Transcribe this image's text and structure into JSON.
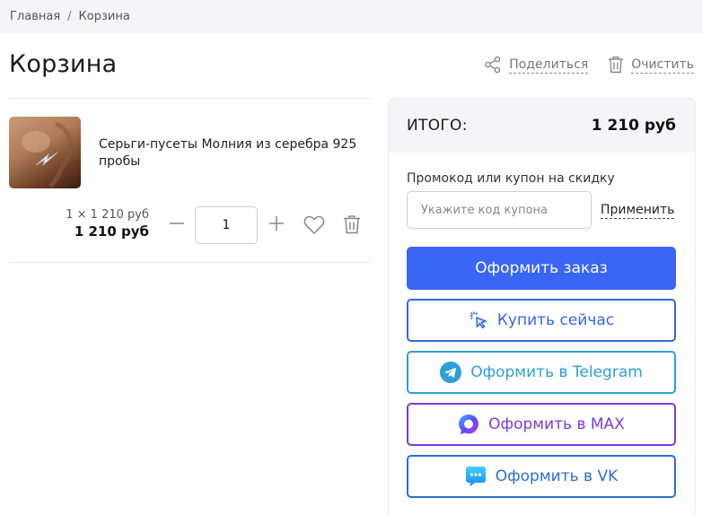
{
  "breadcrumb": {
    "home": "Главная",
    "separator": "/",
    "current": "Корзина"
  },
  "page": {
    "title": "Корзина"
  },
  "actions": {
    "share_label": "Поделиться",
    "clear_label": "Очистить"
  },
  "cart_item": {
    "name": "Серьги-пусеты Молния из серебра 925 пробы",
    "unit_price": "1 × 1 210 руб",
    "total_price": "1 210 руб",
    "quantity": "1"
  },
  "summary": {
    "label": "ИТОГО:",
    "total": "1 210 руб",
    "promo_label": "Промокод или купон на скидку",
    "promo_placeholder": "Укажите код купона",
    "apply_label": "Применить",
    "order_button": "Оформить заказ",
    "buy_now_button": "Купить сейчас",
    "telegram_button": "Оформить в Telegram",
    "max_button": "Оформить в MAX",
    "vk_button": "Оформить в VK"
  },
  "icons": {
    "share": "share-icon",
    "clear": "trash-icon",
    "minus": "minus-icon",
    "plus": "plus-icon",
    "favorite": "heart-icon",
    "delete": "trash-icon",
    "buy_now": "cursor-click-icon",
    "telegram": "telegram-icon",
    "max": "max-icon",
    "vk": "vk-icon"
  },
  "colors": {
    "primary": "#3a66f5",
    "buy_now": "#3467e0",
    "telegram": "#2f9fd8",
    "max": "#7a3cd9",
    "vk": "#2a6fd4"
  }
}
